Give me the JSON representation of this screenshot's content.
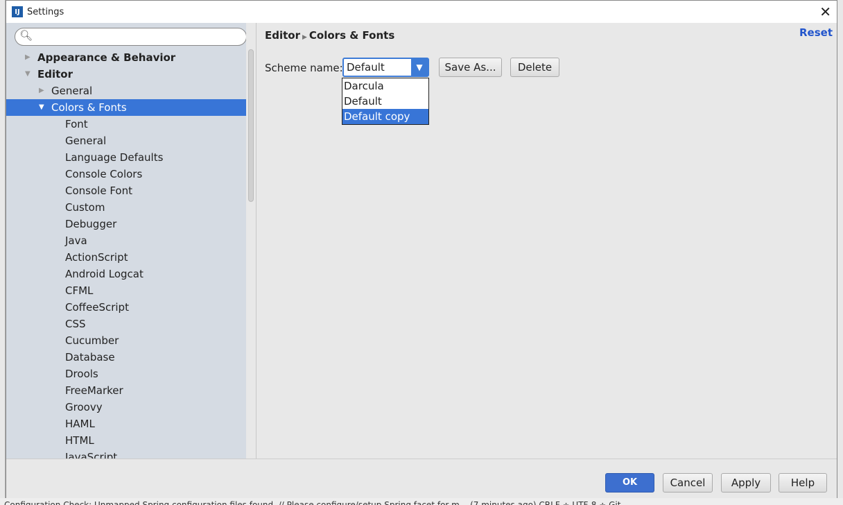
{
  "window": {
    "title": "Settings",
    "close": "✕"
  },
  "search": {
    "placeholder": "",
    "icon": "search-icon"
  },
  "tree": [
    {
      "label": "Appearance & Behavior",
      "level": 0,
      "bold": true,
      "arrow": "right"
    },
    {
      "label": "Editor",
      "level": 0,
      "bold": true,
      "arrow": "down"
    },
    {
      "label": "General",
      "level": 1,
      "arrow": "right"
    },
    {
      "label": "Colors & Fonts",
      "level": 1,
      "arrow": "down",
      "selected": true
    },
    {
      "label": "Font",
      "level": 2
    },
    {
      "label": "General",
      "level": 2
    },
    {
      "label": "Language Defaults",
      "level": 2
    },
    {
      "label": "Console Colors",
      "level": 2
    },
    {
      "label": "Console Font",
      "level": 2
    },
    {
      "label": "Custom",
      "level": 2
    },
    {
      "label": "Debugger",
      "level": 2
    },
    {
      "label": "Java",
      "level": 2
    },
    {
      "label": "ActionScript",
      "level": 2
    },
    {
      "label": "Android Logcat",
      "level": 2
    },
    {
      "label": "CFML",
      "level": 2
    },
    {
      "label": "CoffeeScript",
      "level": 2
    },
    {
      "label": "CSS",
      "level": 2
    },
    {
      "label": "Cucumber",
      "level": 2
    },
    {
      "label": "Database",
      "level": 2
    },
    {
      "label": "Drools",
      "level": 2
    },
    {
      "label": "FreeMarker",
      "level": 2
    },
    {
      "label": "Groovy",
      "level": 2
    },
    {
      "label": "HAML",
      "level": 2
    },
    {
      "label": "HTML",
      "level": 2
    },
    {
      "label": "JavaScript",
      "level": 2
    }
  ],
  "main": {
    "breadcrumb": [
      "Editor",
      "Colors & Fonts"
    ],
    "reset": "Reset",
    "scheme_label": "Scheme name:",
    "scheme_value": "Default copy",
    "save_as": "Save As...",
    "delete": "Delete",
    "options": [
      "Darcula",
      "Default",
      "Default copy"
    ],
    "selected_option": "Default copy"
  },
  "footer": {
    "ok": "OK",
    "cancel": "Cancel",
    "apply": "Apply",
    "help": "Help"
  },
  "status": "Configuration Check: Unmapped Spring configuration files found. // Please configure/setup Spring facet for m... (7 minutes ago)     CRLF ÷   UTF-8 ÷   Git",
  "colors": {
    "accent": "#3875d7",
    "sidebar": "#d5dbe3",
    "ok": "#3d6fcf"
  }
}
